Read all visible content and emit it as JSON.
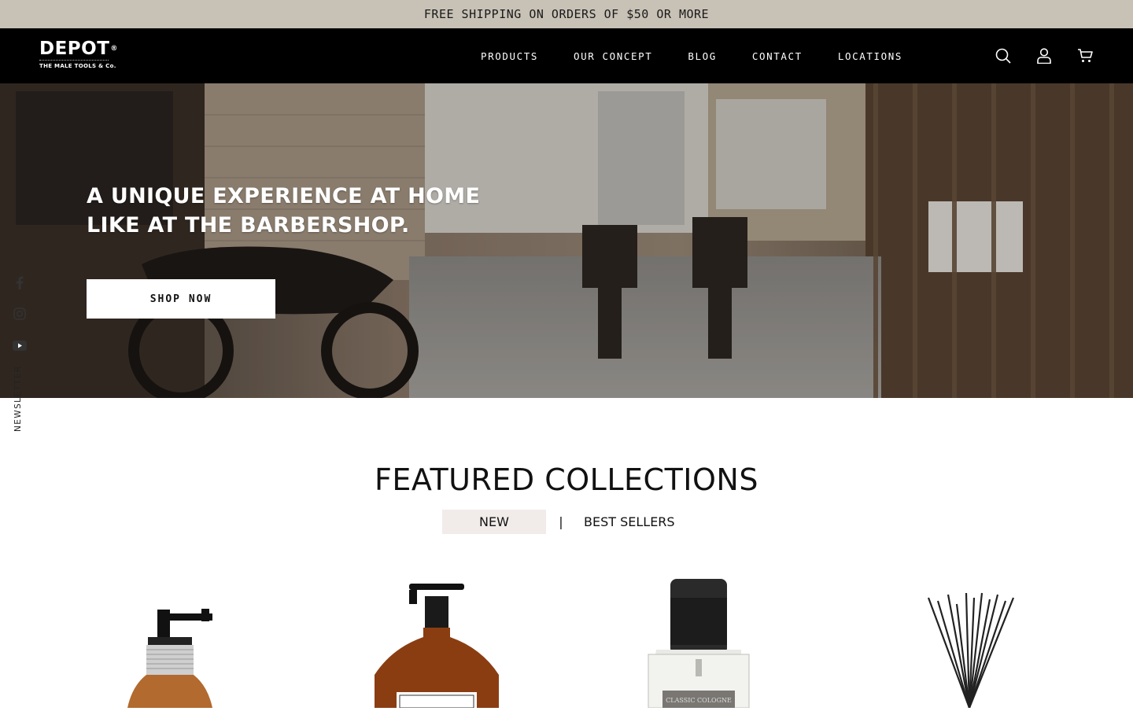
{
  "announcement": "FREE SHIPPING ON ORDERS OF $50 OR MORE",
  "logo": {
    "name": "DEPOT",
    "registered": "®",
    "tagline": "THE MALE TOOLS & Co."
  },
  "nav": [
    "PRODUCTS",
    "OUR CONCEPT",
    "BLOG",
    "CONTACT",
    "LOCATIONS"
  ],
  "header_icons": [
    "search-icon",
    "account-icon",
    "cart-icon"
  ],
  "hero": {
    "title": "A UNIQUE EXPERIENCE AT HOME LIKE AT THE BARBERSHOP.",
    "button": "SHOP NOW"
  },
  "social": [
    "facebook-icon",
    "instagram-icon",
    "youtube-icon"
  ],
  "newsletter": "NEWSLETTER",
  "featured": {
    "title": "FEATURED COLLECTIONS",
    "tabs": [
      "NEW",
      "BEST SELLERS"
    ],
    "separator": "|",
    "active_tab": "NEW"
  },
  "products": [
    {
      "icon": "spray-bottle-image"
    },
    {
      "icon": "pump-bottle-image"
    },
    {
      "icon": "cologne-bottle-image",
      "label": "CLASSIC COLOGNE"
    },
    {
      "icon": "reed-diffuser-image"
    }
  ],
  "colors": {
    "announcement_bg": "#c8c1b6",
    "header_bg": "#000000",
    "active_tab_bg": "#f1ecea"
  }
}
